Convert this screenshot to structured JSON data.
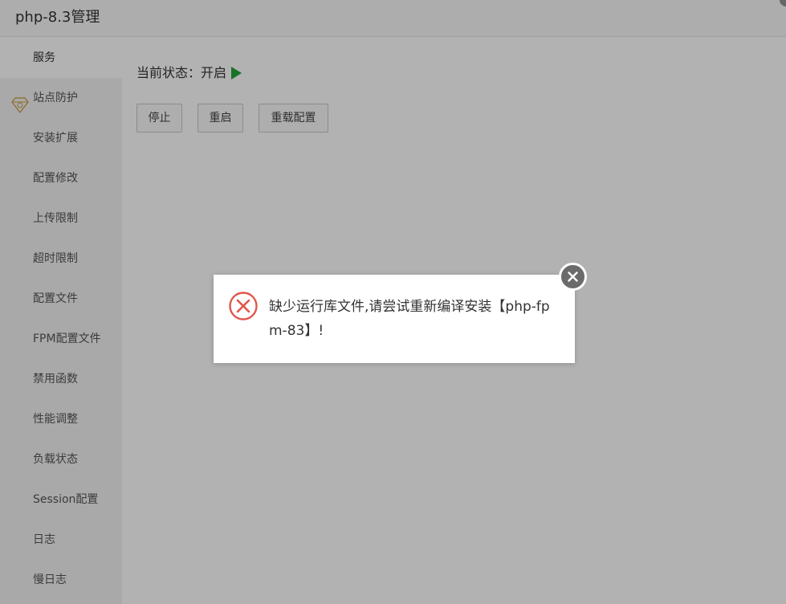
{
  "window": {
    "title": "php-8.3管理"
  },
  "sidebar": {
    "items": [
      {
        "label": "服务",
        "active": true
      },
      {
        "label": "站点防护",
        "icon": "diamond-icon"
      },
      {
        "label": "安装扩展"
      },
      {
        "label": "配置修改"
      },
      {
        "label": "上传限制"
      },
      {
        "label": "超时限制"
      },
      {
        "label": "配置文件"
      },
      {
        "label": "FPM配置文件"
      },
      {
        "label": "禁用函数"
      },
      {
        "label": "性能调整"
      },
      {
        "label": "负载状态"
      },
      {
        "label": "Session配置"
      },
      {
        "label": "日志"
      },
      {
        "label": "慢日志"
      }
    ]
  },
  "main": {
    "status_label": "当前状态：开启",
    "status_icon": "play-icon",
    "status_color": "#20a53a",
    "buttons": {
      "stop": "停止",
      "restart": "重启",
      "reload": "重载配置"
    }
  },
  "dialog": {
    "icon": "error-icon",
    "message": "缺少运行库文件,请尝试重新编译安装【php-fpm-83】!",
    "close_icon": "close-icon",
    "error_color": "#e0574b"
  }
}
